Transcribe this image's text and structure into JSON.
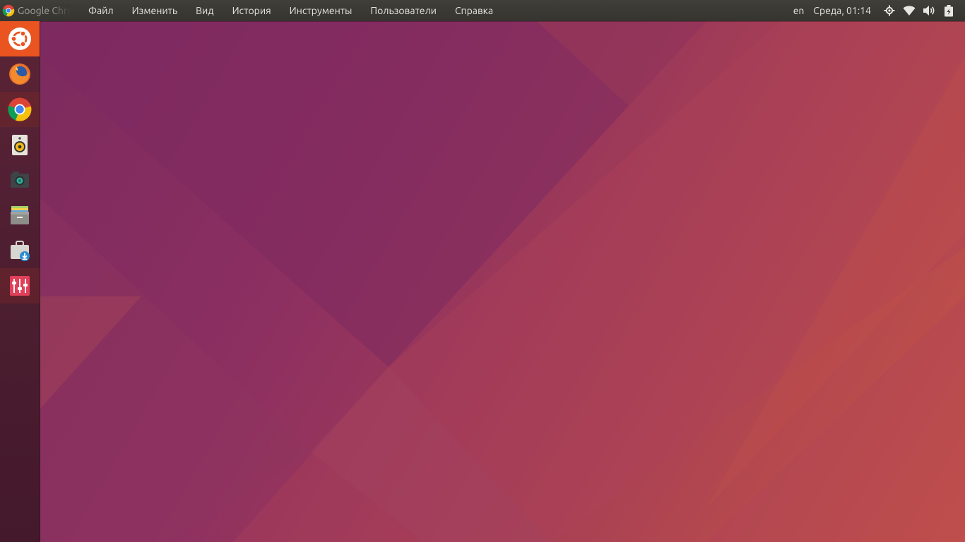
{
  "colors": {
    "panel_bg": "#3c3b37",
    "panel_text": "#e8e6e2",
    "dash_orange": "#e95420",
    "launcher_bg": "#4a1d2f"
  },
  "top_panel": {
    "app_title": "Google Chrome",
    "app_icon": "chrome-icon",
    "menu": [
      {
        "label": "Файл"
      },
      {
        "label": "Изменить"
      },
      {
        "label": "Вид"
      },
      {
        "label": "История"
      },
      {
        "label": "Инструменты"
      },
      {
        "label": "Пользователи"
      },
      {
        "label": "Справка"
      }
    ],
    "indicators": {
      "language": "en",
      "clock": "Среда, 01:14",
      "icons": [
        "network-manager-icon",
        "wifi-icon",
        "volume-icon",
        "battery-icon"
      ]
    }
  },
  "launcher": {
    "items": [
      {
        "name": "dash-button",
        "icon": "ubuntu-logo-icon"
      },
      {
        "name": "launcher-firefox",
        "icon": "firefox-icon"
      },
      {
        "name": "launcher-chrome",
        "icon": "chrome-icon"
      },
      {
        "name": "launcher-rhythmbox",
        "icon": "speaker-icon"
      },
      {
        "name": "launcher-camera",
        "icon": "camera-icon"
      },
      {
        "name": "launcher-files",
        "icon": "file-cabinet-icon"
      },
      {
        "name": "launcher-software",
        "icon": "software-center-icon"
      },
      {
        "name": "launcher-mixer",
        "icon": "mixer-icon"
      }
    ]
  }
}
